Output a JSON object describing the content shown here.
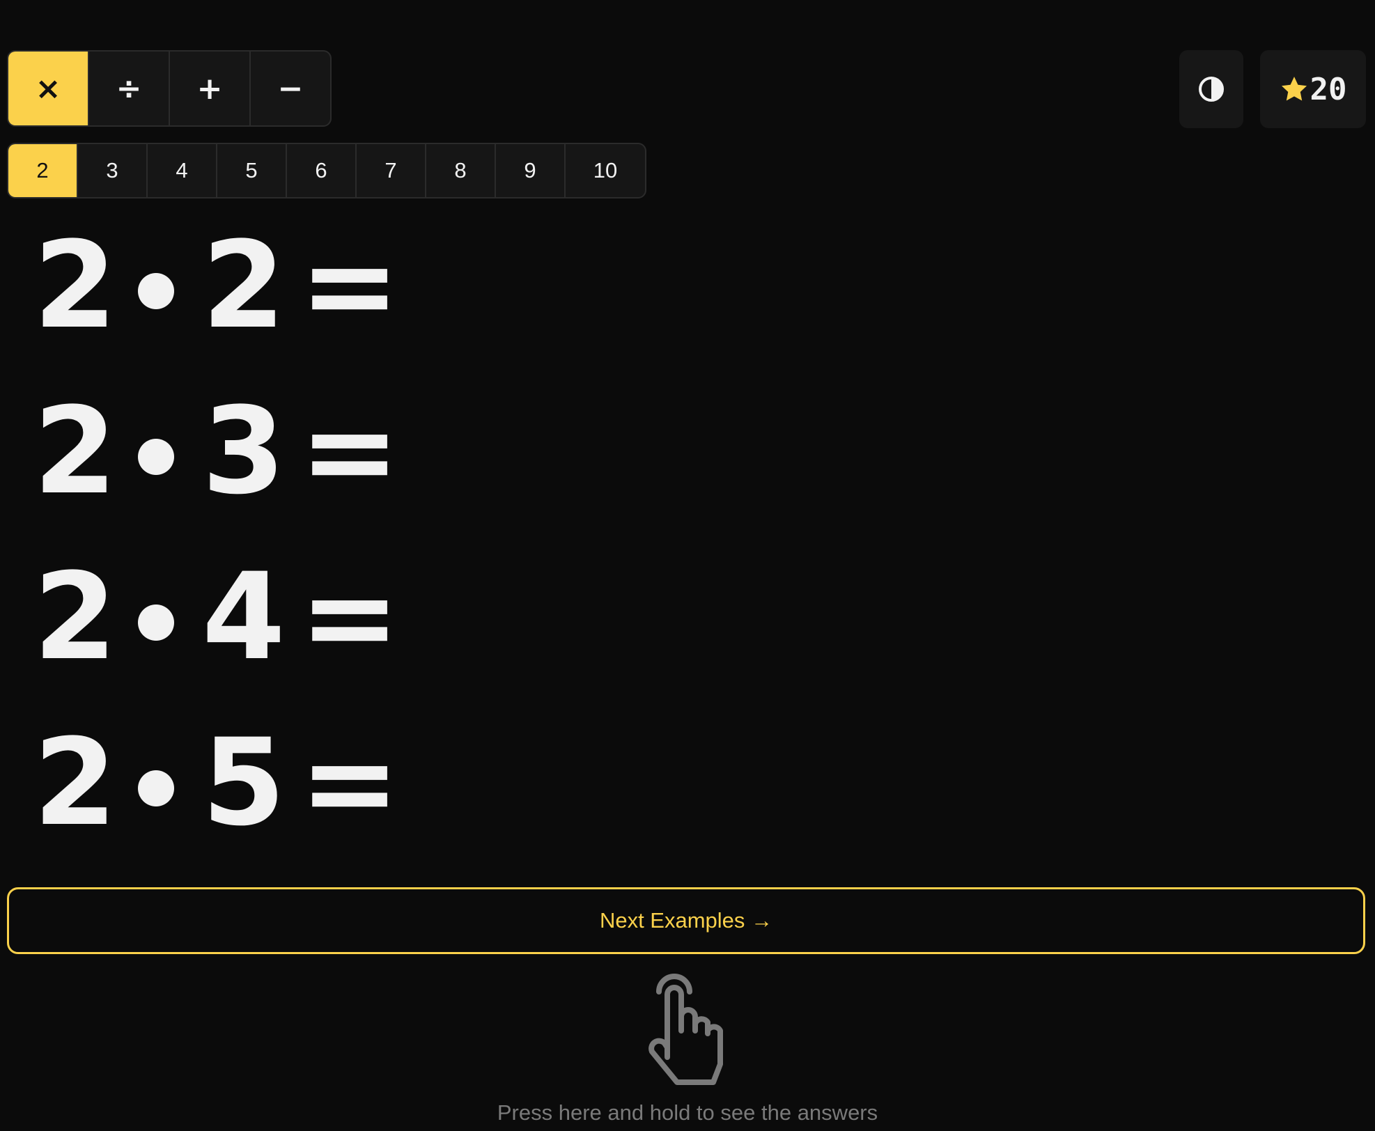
{
  "operations": [
    {
      "symbol": "×",
      "active": true
    },
    {
      "symbol": "÷",
      "active": false
    },
    {
      "symbol": "+",
      "active": false
    },
    {
      "symbol": "−",
      "active": false
    }
  ],
  "numbers": [
    {
      "label": "2",
      "active": true
    },
    {
      "label": "3",
      "active": false
    },
    {
      "label": "4",
      "active": false
    },
    {
      "label": "5",
      "active": false
    },
    {
      "label": "6",
      "active": false
    },
    {
      "label": "7",
      "active": false
    },
    {
      "label": "8",
      "active": false
    },
    {
      "label": "9",
      "active": false
    },
    {
      "label": "10",
      "active": false
    }
  ],
  "controls": {
    "contrast_icon": "contrast-icon",
    "star_icon": "star-icon",
    "stars": "20"
  },
  "examples": [
    {
      "a": "2",
      "b": "2",
      "eq": "="
    },
    {
      "a": "2",
      "b": "3",
      "eq": "="
    },
    {
      "a": "2",
      "b": "4",
      "eq": "="
    },
    {
      "a": "2",
      "b": "5",
      "eq": "="
    }
  ],
  "next_button": {
    "label": "Next Examples →"
  },
  "hint": {
    "text": "Press here and hold to see the answers",
    "icon": "hand-pointer-icon"
  },
  "colors": {
    "accent": "#fbd14b",
    "background": "#0b0b0b",
    "panel": "#171717",
    "text": "#f2f2f2",
    "muted": "#7a7a7a"
  }
}
